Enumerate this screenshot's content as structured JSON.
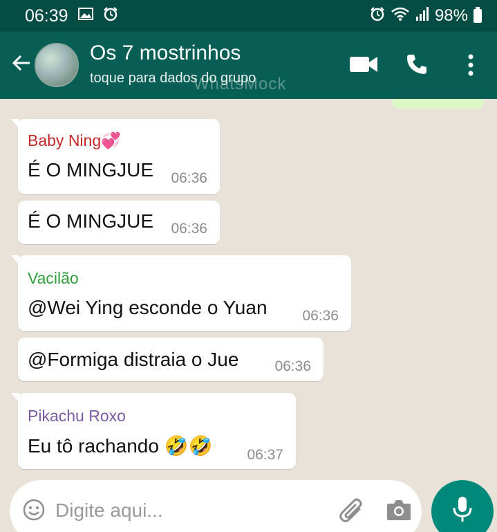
{
  "status_bar": {
    "time": "06:39",
    "battery": "98%"
  },
  "header": {
    "group_name": "Os 7 mostrinhos",
    "subtitle": "toque para dados do grupo",
    "watermark": "WhatsMock"
  },
  "messages": [
    {
      "sender": "Baby Ning💞",
      "sender_color": "#c62828",
      "text": "É O MINGJUE",
      "time": "06:36"
    },
    {
      "sender": "",
      "text": "É O MINGJUE",
      "time": "06:36"
    },
    {
      "sender": "Vacilão",
      "sender_color": "#2e9e3b",
      "text": "@Wei Ying  esconde o Yuan",
      "time": "06:36"
    },
    {
      "sender": "",
      "text": "@Formiga distraia o Jue",
      "time": "06:36"
    },
    {
      "sender": "Pikachu Roxo",
      "sender_color": "#7b5aa6",
      "text": "Eu tô rachando 🤣🤣",
      "time": "06:37"
    }
  ],
  "composer": {
    "placeholder": "Digite aqui..."
  },
  "icons": {
    "status": [
      "image-icon",
      "alarm-icon",
      "wifi-icon",
      "signal-icon",
      "battery-icon"
    ],
    "header": [
      "back-arrow-icon",
      "video-call-icon",
      "phone-icon",
      "more-vert-icon"
    ],
    "composer": [
      "emoji-icon",
      "attach-icon",
      "camera-icon",
      "mic-icon"
    ]
  },
  "colors": {
    "header": "#075e54",
    "status_bar": "#054d44",
    "mic": "#00897b",
    "outgoing": "#dcf8c6"
  }
}
